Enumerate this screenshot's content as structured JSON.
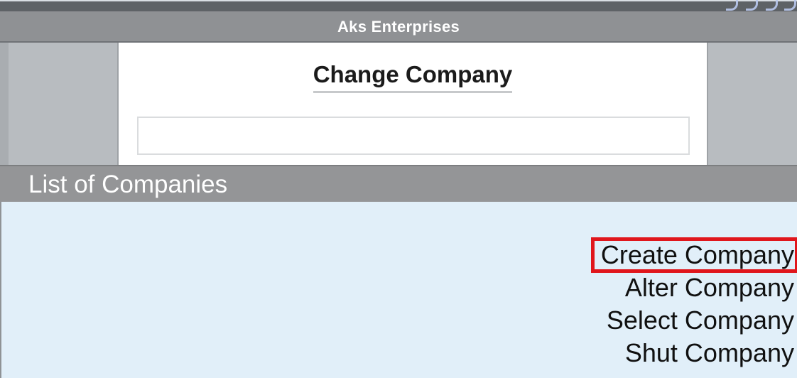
{
  "window": {
    "company_title": "Aks Enterprises"
  },
  "dialog": {
    "title": "Change Company",
    "input_value": ""
  },
  "list": {
    "header": "List of Companies",
    "items": [
      {
        "label": "Create Company",
        "highlighted": true
      },
      {
        "label": "Alter Company",
        "highlighted": false
      },
      {
        "label": "Select Company",
        "highlighted": false
      },
      {
        "label": "Shut Company",
        "highlighted": false
      }
    ]
  },
  "colors": {
    "title_bar": "#8f9194",
    "list_header": "#949597",
    "list_body": "#e1eff9",
    "highlight_border": "#e0161c"
  }
}
